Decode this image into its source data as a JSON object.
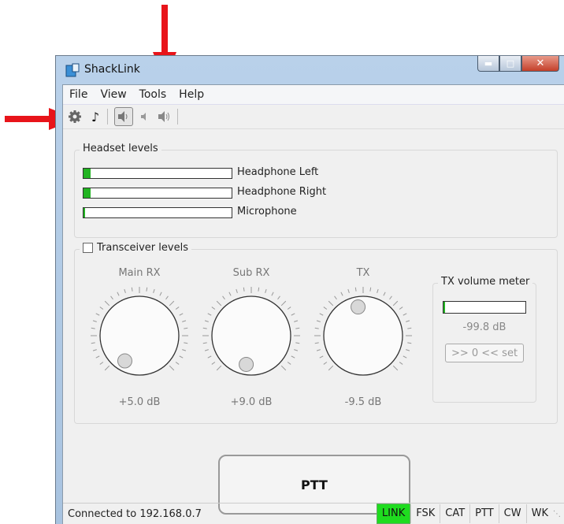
{
  "window": {
    "title": "ShackLink"
  },
  "menu": [
    "File",
    "View",
    "Tools",
    "Help"
  ],
  "toolbar": {
    "icons": [
      "gear-icon",
      "music-note-icon",
      "speaker-icon",
      "volume-low-icon",
      "speaker-waves-icon"
    ]
  },
  "headset": {
    "label": "Headset levels",
    "meters": [
      {
        "label": "Headphone Left",
        "level": 0.05
      },
      {
        "label": "Headphone Right",
        "level": 0.05
      },
      {
        "label": "Microphone",
        "level": 0.01
      }
    ]
  },
  "transceiver": {
    "label": "Transceiver levels",
    "checked": false,
    "knobs": [
      {
        "label": "Main RX",
        "value": "+5.0 dB",
        "angle_deg": 240
      },
      {
        "label": "Sub RX",
        "value": "+9.0 dB",
        "angle_deg": 260
      },
      {
        "label": "TX",
        "value": "-9.5 dB",
        "angle_deg": 100
      }
    ],
    "tx_meter": {
      "label": "TX volume meter",
      "value": "-99.8 dB",
      "level": 0.02,
      "set_label": ">> 0 << set"
    }
  },
  "ptt_label": "PTT",
  "status": {
    "text": "Connected to 192.168.0.7",
    "cells": [
      {
        "label": "LINK",
        "active": true
      },
      {
        "label": "FSK",
        "active": false
      },
      {
        "label": "CAT",
        "active": false
      },
      {
        "label": "PTT",
        "active": false
      },
      {
        "label": "CW",
        "active": false
      },
      {
        "label": "WK",
        "active": false
      }
    ]
  },
  "colors": {
    "arrow": "#e8141a",
    "meter_fill": "#22b422",
    "link_on": "#1fdc1f"
  }
}
